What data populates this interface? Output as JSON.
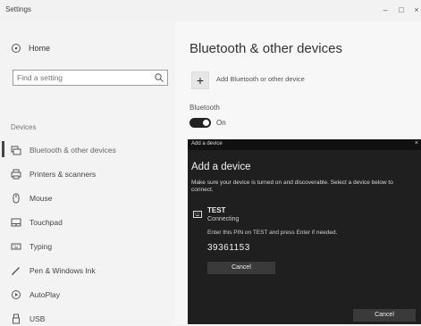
{
  "window": {
    "title": "Settings",
    "min_glyph": "–",
    "max_glyph": "□",
    "close_glyph": "×"
  },
  "sidebar": {
    "home_label": "Home",
    "search_placeholder": "Find a setting",
    "section_label": "Devices",
    "items": [
      {
        "label": "Bluetooth & other devices",
        "icon": "bluetooth-icon"
      },
      {
        "label": "Printers & scanners",
        "icon": "printer-icon"
      },
      {
        "label": "Mouse",
        "icon": "mouse-icon"
      },
      {
        "label": "Touchpad",
        "icon": "touchpad-icon"
      },
      {
        "label": "Typing",
        "icon": "keyboard-icon"
      },
      {
        "label": "Pen & Windows Ink",
        "icon": "pen-icon"
      },
      {
        "label": "AutoPlay",
        "icon": "autoplay-icon"
      },
      {
        "label": "USB",
        "icon": "usb-icon"
      }
    ]
  },
  "main": {
    "title": "Bluetooth & other devices",
    "add_glyph": "+",
    "add_label": "Add Bluetooth or other device",
    "bluetooth_label": "Bluetooth",
    "toggle_state": "On"
  },
  "dialog": {
    "title": "Add a device",
    "close_glyph": "×",
    "heading": "Add a device",
    "instructions": "Make sure your device is turned on and discoverable. Select a device below to connect.",
    "device": {
      "name": "TEST",
      "status": "Connecting",
      "pin_instruction": "Enter this PIN on TEST and press Enter if needed.",
      "pin": "39361153",
      "cancel_label": "Cancel"
    },
    "footer_cancel_label": "Cancel"
  },
  "colors": {
    "dialog_bg": "#1f1f1f",
    "toggle_on": "#222222",
    "window_bg": "#f7f7f7"
  }
}
